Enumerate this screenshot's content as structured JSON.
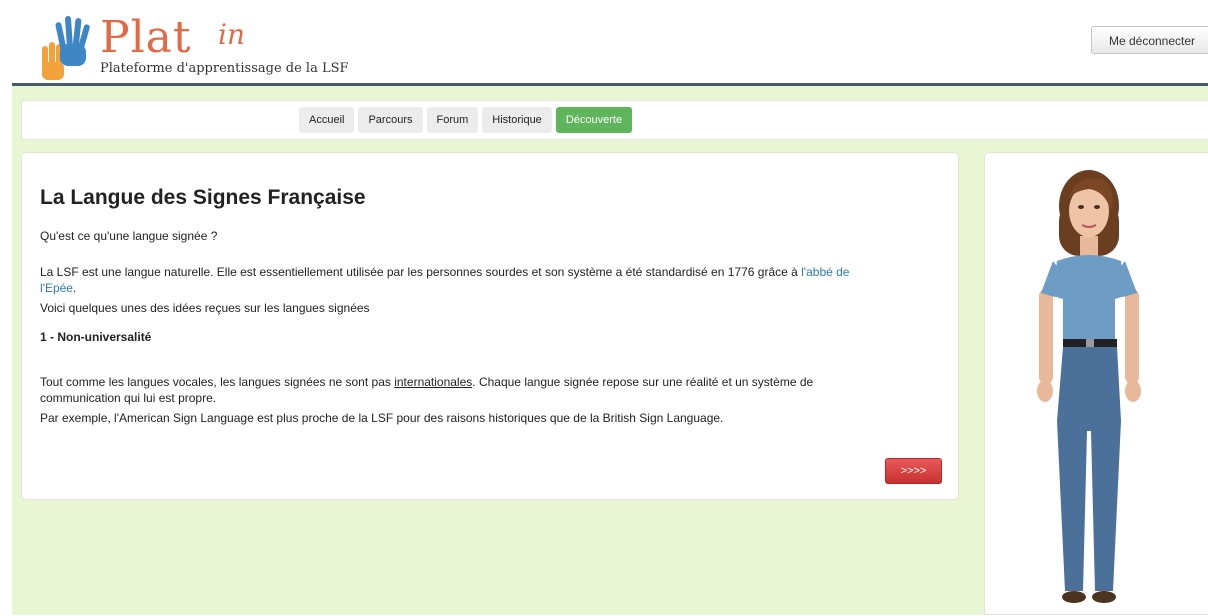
{
  "header": {
    "logo_title": "Plat",
    "logo_sup": "in",
    "logo_subtitle": "Plateforme d'apprentissage de la LSF",
    "logout_label": "Me déconnecter"
  },
  "nav": {
    "tabs": [
      {
        "label": "Accueil",
        "active": false
      },
      {
        "label": "Parcours",
        "active": false
      },
      {
        "label": "Forum",
        "active": false
      },
      {
        "label": "Historique",
        "active": false
      },
      {
        "label": "Découverte",
        "active": true
      }
    ]
  },
  "content": {
    "title": "La Langue des Signes Française",
    "question": "Qu'est ce qu'une langue signée ?",
    "para1_text": "La LSF est une langue naturelle. Elle est essentiellement utilisée par les personnes sourdes et son système a été standardisé en 1776 grâce à ",
    "para1_link_a": "l'abbé de",
    "para1_link_b": "l'Epée",
    "para1_end": ".",
    "para2": "Voici quelques unes des idées reçues sur les langues signées",
    "section_heading": "1 - Non-universalité",
    "para3_pre": "Tout comme les langues vocales, les langues signées ne sont pas ",
    "para3_link": "internationales",
    "para3_post": ". Chaque langue signée repose sur une réalité et un système de",
    "para3_line2": "communication qui lui est propre.",
    "para4": "Par exemple, l'American Sign Language est plus proche de la LSF pour des raisons historiques que de la British Sign Language.",
    "next_label": ">>>>"
  },
  "colors": {
    "brand": "#e46a46",
    "active_tab": "#5fb55b",
    "background": "#e8f6d4",
    "next_button": "#d84040",
    "link": "#2a7bbf"
  }
}
